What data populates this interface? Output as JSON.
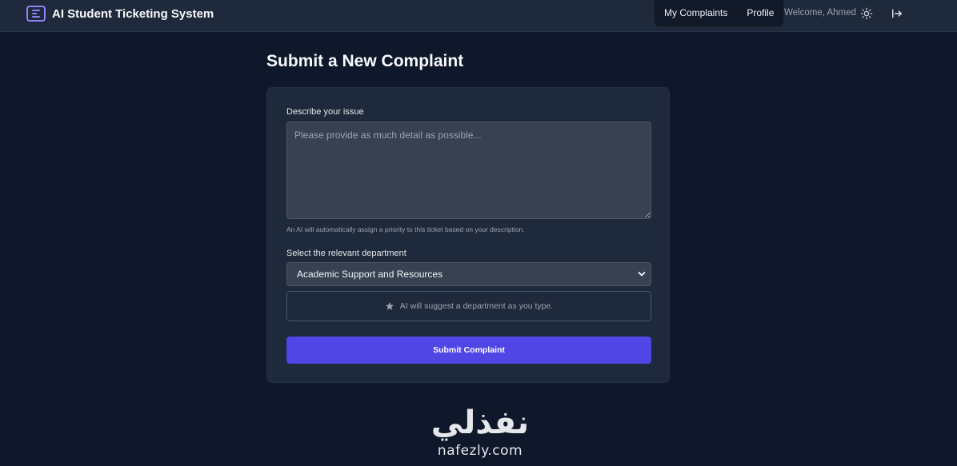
{
  "header": {
    "app_title": "AI Student Ticketing System",
    "nav": [
      {
        "label": "My Complaints"
      },
      {
        "label": "Profile"
      }
    ],
    "welcome": "Welcome, Ahmed",
    "icons": {
      "brand": "document-list-icon",
      "theme": "sun-icon",
      "logout": "logout-icon"
    }
  },
  "main": {
    "title": "Submit a New Complaint",
    "form": {
      "issue_label": "Describe your issue",
      "issue_placeholder": "Please provide as much detail as possible...",
      "issue_value": "",
      "issue_help": "An AI will automatically assign a priority to this ticket based on your description.",
      "department_label": "Select the relevant department",
      "department_selected": "Academic Support and Resources",
      "ai_suggestion": "AI will suggest a department as you type.",
      "submit_label": "Submit Complaint"
    }
  },
  "watermark": {
    "arabic": "نفذلي",
    "latin": "nafezly.com"
  },
  "colors": {
    "background": "#0f172a",
    "surface": "#1e293b",
    "input": "#374151",
    "accent": "#4f46e5",
    "brand_icon": "#8b84f6"
  }
}
